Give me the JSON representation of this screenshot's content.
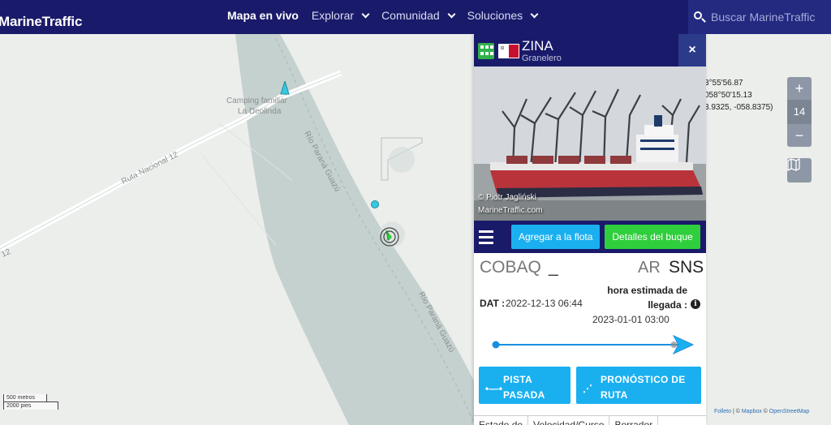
{
  "header": {
    "logo": "MarineTraffic",
    "nav": [
      {
        "label": "Mapa en vivo",
        "active": true,
        "has_dropdown": false
      },
      {
        "label": "Explorar",
        "active": false,
        "has_dropdown": true
      },
      {
        "label": "Comunidad",
        "active": false,
        "has_dropdown": true
      },
      {
        "label": "Soluciones",
        "active": false,
        "has_dropdown": true
      }
    ],
    "search_placeholder": "Buscar MarineTraffic"
  },
  "map": {
    "labels": {
      "camping_line1": "Camping familiar",
      "camping_line2": "La Deolinda",
      "road": "Ruta Nacional 12",
      "road_edge": "12",
      "river_1": "Río Paraná Guazú",
      "river_2": "Río Paraná Guazú"
    },
    "coordinates": {
      "lat": "3°55'56.87",
      "lon": "058°50'15.13",
      "decimal": "3.9325, -058.8375)"
    },
    "zoom": {
      "in": "+",
      "level": "14",
      "out": "−"
    },
    "scale": {
      "metric": "500 metros",
      "imperial": "2000 pies"
    },
    "attribution": {
      "leaflet": "Folleto",
      "sep1": " | © ",
      "mapbox": "Mapbox",
      "sep2": " © ",
      "osm": "OpenStreetMap"
    },
    "colors": {
      "land": "#eceeec",
      "water": "#c5d1cf",
      "ship_marker": "#2fce3c",
      "vessel_cyan": "#36c8df"
    }
  },
  "ship_panel": {
    "name": "ZINA",
    "type": "Granelero",
    "close": "×",
    "photo_credit_1": "© Piotr Jagliński",
    "photo_credit_2": "MarineTraffic.com",
    "buttons": {
      "add_fleet": "Agregar a la flota",
      "details": "Detalles del buque"
    },
    "route": {
      "from_port": "COBAQ",
      "from_cursor": "_",
      "to_country": "AR",
      "to_port": "SNS",
      "atd_label": "DAT :",
      "atd_value": "2022-12-13 06:44",
      "eta_label_1": "hora estimada de",
      "eta_label_2": "llegada :",
      "eta_value": "2023-01-01 03:00",
      "progress": 0.95
    },
    "route_buttons": {
      "past_line1": "PISTA",
      "past_line2": "PASADA",
      "forecast_line1": "PRONÓSTICO DE",
      "forecast_line2": "RUTA"
    },
    "tabs": [
      "Estado de",
      "Velocidad/Curso",
      "Borrador"
    ],
    "colors": {
      "header": "#1a1a6a",
      "blue_button": "#1ab0f0",
      "green_button": "#2fce3c",
      "flag_red": "#c8102e"
    }
  }
}
